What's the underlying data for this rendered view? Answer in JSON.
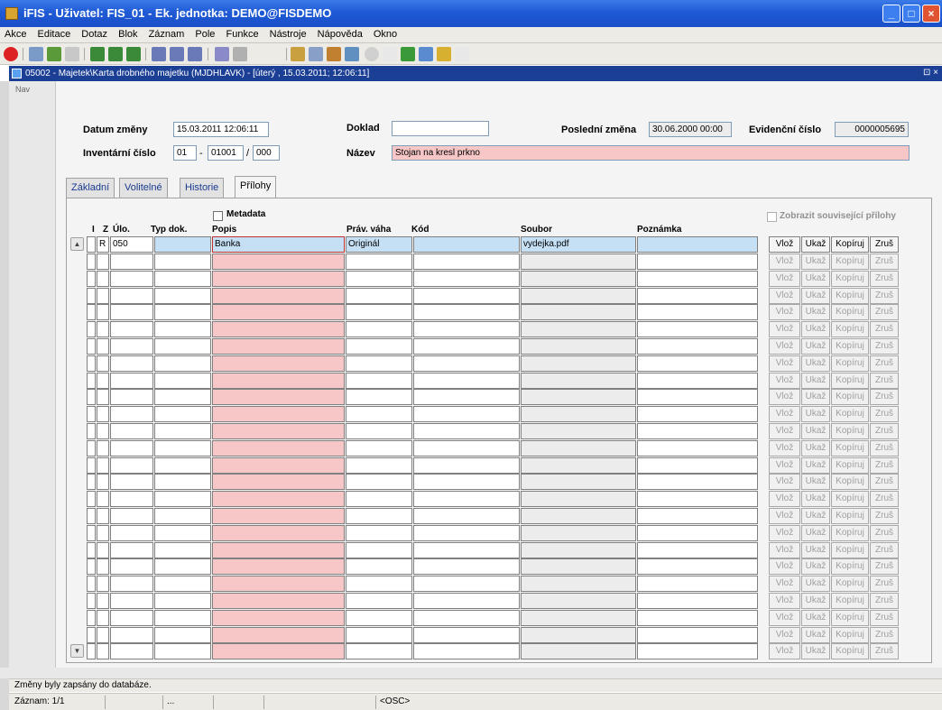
{
  "window": {
    "title": "iFIS - Uživatel: FIS_01 - Ek. jednotka: DEMO@FISDEMO",
    "minimize": "_",
    "maximize": "□",
    "close": "×"
  },
  "menu": [
    "Akce",
    "Editace",
    "Dotaz",
    "Blok",
    "Záznam",
    "Pole",
    "Funkce",
    "Nástroje",
    "Nápověda",
    "Okno"
  ],
  "toolbar_icons": [
    "exit-icon",
    "save-icon",
    "print-icon",
    "query-icon",
    "find-icon",
    "sort-asc-icon",
    "sort-desc-icon",
    "filter-icon",
    "copy-icon",
    "paste-icon",
    "cut-icon",
    "help-icon",
    "sum-icon",
    "excel-icon",
    "info-icon"
  ],
  "inner_window": {
    "title": "05002 - Majetek\\Karta drobného majetku (MJDHLAVK) - [úterý , 15.03.2011; 12:06:11]",
    "restore": "⊡ ×"
  },
  "nav": "Nav",
  "header": {
    "datum_label": "Datum změny",
    "datum_value": "15.03.2011 12:06:11",
    "doklad_label": "Doklad",
    "doklad_value": "",
    "posledni_label": "Poslední změna",
    "posledni_value": "30.06.2000 00:00",
    "evidencni_label": "Evidenční číslo",
    "evidencni_value": "0000005695",
    "inventarni_label": "Inventární číslo",
    "inv1": "01",
    "inv_sep1": "-",
    "inv2": "01001",
    "inv_sep2": "/",
    "inv3": "000",
    "nazev_label": "Název",
    "nazev_value": "Stojan na kresl prkno"
  },
  "tabs": [
    "Základní",
    "Volitelné",
    "Historie",
    "Přílohy"
  ],
  "table": {
    "metadata_label": "Metadata",
    "zobrazit_label": "Zobrazit související přílohy",
    "columns": [
      "I",
      "Z",
      "Úlo.",
      "Typ dok.",
      "Popis",
      "Práv. váha",
      "Kód",
      "Soubor",
      "Poznámka"
    ],
    "first_row": {
      "i": "",
      "z": "R",
      "ulo": "050",
      "typ": "",
      "popis": "Banka",
      "vaha": "Originál",
      "kod": "",
      "soubor": "vydejka.pdf",
      "poznamka": ""
    },
    "row_count": 25,
    "buttons": [
      "Vlož",
      "Ukaž",
      "Kopíruj",
      "Zruš"
    ]
  },
  "status": {
    "message": "Změny byly zapsány do databáze.",
    "record": "Záznam: 1/1",
    "seg3": "...",
    "osc": "<OSC>"
  }
}
